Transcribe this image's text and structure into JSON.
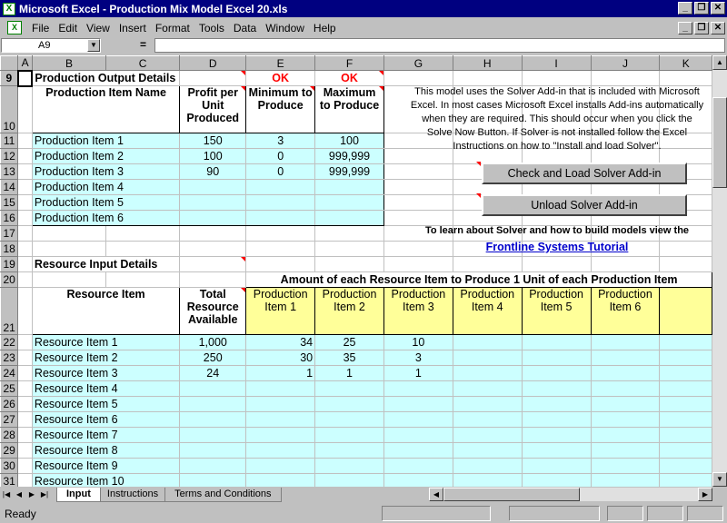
{
  "window": {
    "title": "Microsoft Excel - Production Mix Model Excel 20.xls",
    "min": "_",
    "max": "❐",
    "close": "✕"
  },
  "menu": {
    "items": [
      "File",
      "Edit",
      "View",
      "Insert",
      "Format",
      "Tools",
      "Data",
      "Window",
      "Help"
    ]
  },
  "formula_bar": {
    "name_box": "A9",
    "equals": "=",
    "content": ""
  },
  "columns": [
    "A",
    "B",
    "C",
    "D",
    "E",
    "F",
    "G",
    "H",
    "I",
    "J",
    "K"
  ],
  "sheet": {
    "output_title": "Production Output Details",
    "ok_e": "OK",
    "ok_f": "OK",
    "hdr_item": "Production Item Name",
    "hdr_profit": "Profit per Unit Produced",
    "hdr_min": "Minimum to Produce",
    "hdr_max": "Maximum to Produce",
    "products": [
      {
        "name": "Production Item 1",
        "profit": "150",
        "min": "3",
        "max": "100"
      },
      {
        "name": "Production Item 2",
        "profit": "100",
        "min": "0",
        "max": "999,999"
      },
      {
        "name": "Production Item 3",
        "profit": "90",
        "min": "0",
        "max": "999,999"
      },
      {
        "name": "Production Item 4",
        "profit": "",
        "min": "",
        "max": ""
      },
      {
        "name": "Production Item 5",
        "profit": "",
        "min": "",
        "max": ""
      },
      {
        "name": "Production Item 6",
        "profit": "",
        "min": "",
        "max": ""
      }
    ],
    "info_text": "This model uses the Solver Add-in that is included with Microsoft Excel. In most cases Microsoft Excel installs Add-ins automatically when they are required. This should occur when you click the Solve Now Button. If Solver is not installed follow the Excel Instructions on how to \"Install and load Solver\".",
    "btn_check": "Check and Load Solver Add-in",
    "btn_unload": "Unload Solver Add-in",
    "learn_text": "To learn about Solver and how to build models view the",
    "tutorial_link": "Frontline Systems Tutorial",
    "resource_title": "Resource Input Details",
    "amount_header": "Amount of each Resource Item to Produce 1 Unit of each Production Item",
    "hdr_resource": "Resource Item",
    "hdr_total": "Total Resource Available",
    "prod_cols": [
      "Production Item 1",
      "Production Item 2",
      "Production Item 3",
      "Production Item 4",
      "Production Item 5",
      "Production Item 6"
    ],
    "resources": [
      {
        "name": "Resource Item 1",
        "total": "1,000",
        "p1": "34",
        "p2": "25",
        "p3": "10"
      },
      {
        "name": "Resource Item 2",
        "total": "250",
        "p1": "30",
        "p2": "35",
        "p3": "3"
      },
      {
        "name": "Resource Item 3",
        "total": "24",
        "p1": "1",
        "p2": "1",
        "p3": "1"
      },
      {
        "name": "Resource Item 4",
        "total": "",
        "p1": "",
        "p2": "",
        "p3": ""
      },
      {
        "name": "Resource Item 5",
        "total": "",
        "p1": "",
        "p2": "",
        "p3": ""
      },
      {
        "name": "Resource Item 6",
        "total": "",
        "p1": "",
        "p2": "",
        "p3": ""
      },
      {
        "name": "Resource Item 7",
        "total": "",
        "p1": "",
        "p2": "",
        "p3": ""
      },
      {
        "name": "Resource Item 8",
        "total": "",
        "p1": "",
        "p2": "",
        "p3": ""
      },
      {
        "name": "Resource Item 9",
        "total": "",
        "p1": "",
        "p2": "",
        "p3": ""
      },
      {
        "name": "Resource Item 10",
        "total": "",
        "p1": "",
        "p2": "",
        "p3": ""
      }
    ]
  },
  "tabs": [
    "Input",
    "Instructions",
    "Terms and Conditions"
  ],
  "status": {
    "text": "Ready"
  }
}
